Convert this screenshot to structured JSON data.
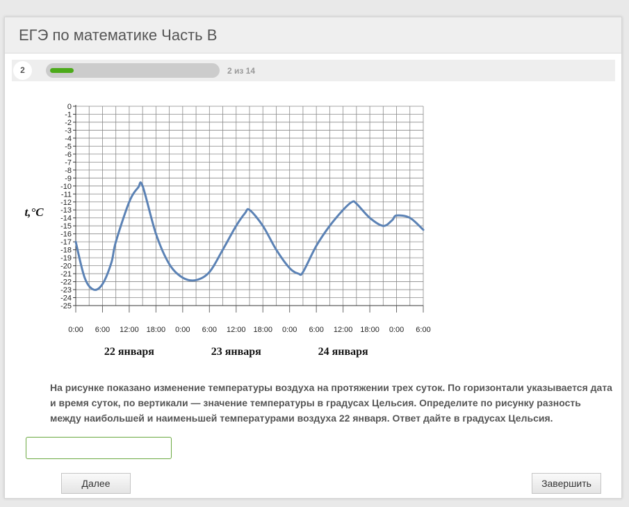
{
  "header": {
    "title": "ЕГЭ по математике Часть B"
  },
  "progress": {
    "current": "2",
    "text": "2 из 14",
    "fraction": 0.142857
  },
  "question": {
    "text": "На рисунке показано изменение температуры воздуха на протяжении трех суток. По горизонтали указывается дата и время суток, по вертикали — значение температуры в градусах Цельсия. Определите по рисунку разность между наибольшей и наименьшей температурами воздуха 22 января. Ответ дайте в градусах Цельсия."
  },
  "answer": {
    "value": ""
  },
  "buttons": {
    "next": "Далее",
    "finish": "Завершить"
  },
  "colors": {
    "line": "#5b82b5",
    "grid": "#888888",
    "progress_fill": "#4caa1a"
  },
  "chart_data": {
    "type": "line",
    "ylabel": "t,°C",
    "xlabel": "",
    "ylim": [
      -25,
      0
    ],
    "xlim": [
      0,
      78
    ],
    "y_ticks": [
      0,
      -1,
      -2,
      -3,
      -4,
      -5,
      -6,
      -7,
      -8,
      -9,
      -10,
      -11,
      -12,
      -13,
      -14,
      -15,
      -16,
      -17,
      -18,
      -19,
      -20,
      -21,
      -22,
      -23,
      -24,
      -25
    ],
    "x_tick_hours": [
      0,
      6,
      12,
      18,
      24,
      30,
      36,
      42,
      48,
      54,
      60,
      66,
      72,
      78
    ],
    "x_tick_labels": [
      "0:00",
      "6:00",
      "12:00",
      "18:00",
      "0:00",
      "6:00",
      "12:00",
      "18:00",
      "0:00",
      "6:00",
      "12:00",
      "18:00",
      "0:00",
      "6:00"
    ],
    "x_minor_step_hours": 3,
    "date_labels": [
      {
        "text": "22 января",
        "at_hour": 12
      },
      {
        "text": "23 января",
        "at_hour": 36
      },
      {
        "text": "24 января",
        "at_hour": 60
      }
    ],
    "grid": true,
    "series": [
      {
        "x": [
          0,
          2,
          4,
          6,
          8,
          9,
          12,
          14,
          15,
          18,
          21,
          24,
          27,
          30,
          33,
          36,
          38,
          39,
          42,
          45,
          48,
          50,
          51,
          54,
          57,
          60,
          62,
          63,
          66,
          69,
          71,
          72,
          75,
          78
        ],
        "y": [
          -17,
          -21.5,
          -23,
          -22.3,
          -19.6,
          -17,
          -12,
          -10.2,
          -10,
          -16,
          -19.8,
          -21.5,
          -21.8,
          -20.8,
          -18,
          -15,
          -13.4,
          -13,
          -15,
          -18,
          -20.3,
          -21,
          -20.8,
          -17.5,
          -15,
          -13,
          -12,
          -12.2,
          -14,
          -15,
          -14.3,
          -13.7,
          -14,
          -15.5
        ]
      }
    ]
  }
}
